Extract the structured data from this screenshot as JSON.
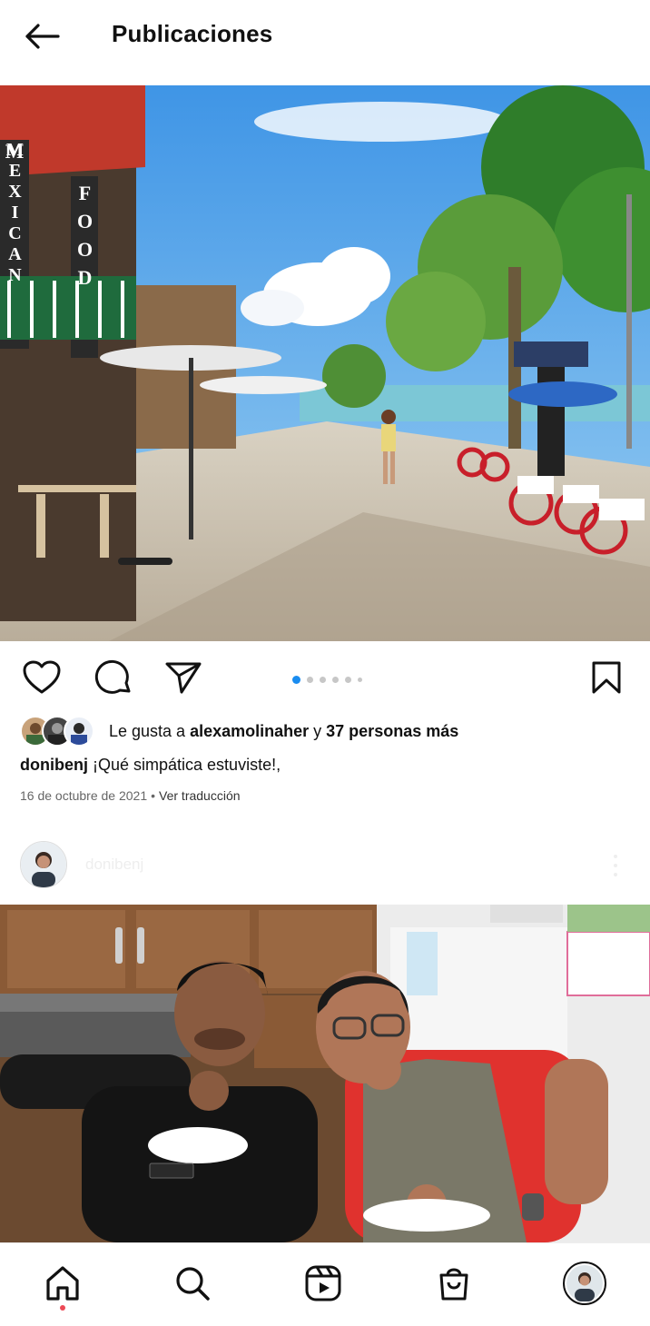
{
  "header": {
    "title": "Publicaciones"
  },
  "post1": {
    "photo_signs": {
      "sign_left": "MEXICAN",
      "sign_right": "FOOD"
    },
    "carousel": {
      "count": 6,
      "active_index": 0
    },
    "likes": {
      "prefix": "Le gusta a ",
      "user": "alexamolinaher",
      "connector": " y ",
      "others": "37 personas más"
    },
    "caption": {
      "user": "donibenj",
      "text": " ¡Qué simpática estuviste!,"
    },
    "date": "16 de octubre de 2021",
    "separator": "•",
    "translate_label": "Ver traducción"
  },
  "post2": {
    "username": "donibenj"
  },
  "colors": {
    "accent": "#1a8cf0",
    "notification": "#ed4956",
    "text": "#111111",
    "muted": "#666666"
  },
  "icons": {
    "back": "arrow-left-icon",
    "like": "heart-icon",
    "comment": "comment-icon",
    "share": "send-icon",
    "save": "bookmark-icon",
    "nav": [
      "home-icon",
      "search-icon",
      "reels-icon",
      "shop-icon",
      "profile-avatar"
    ]
  }
}
